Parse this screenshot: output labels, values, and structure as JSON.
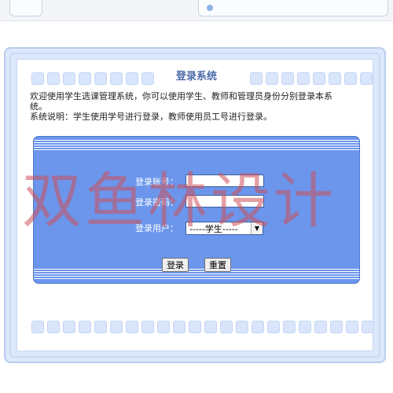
{
  "page": {
    "title": "登录系统",
    "intro_line1": "欢迎使用学生选课管理系统，你可以使用学生、教师和管理员身份分别登录本系",
    "intro_line2": "统。",
    "intro_line3": "系统说明：学生使用学号进行登录，教师使用员工号进行登录。"
  },
  "login": {
    "account_label": "登录账号：",
    "password_label": "登录密码：",
    "user_label": "登录用户：",
    "account_value": "",
    "password_value": "",
    "user_selected": "-----学生-----",
    "login_button": "登录",
    "reset_button": "重置"
  },
  "watermark": {
    "text": "双鱼林设计"
  },
  "colors": {
    "login_panel": "#6b96ec",
    "frame": "#dce8fb",
    "title": "#4a6aa6",
    "watermark": "#cd505a"
  },
  "icons": {
    "select_arrow": "chevron-down-icon"
  }
}
